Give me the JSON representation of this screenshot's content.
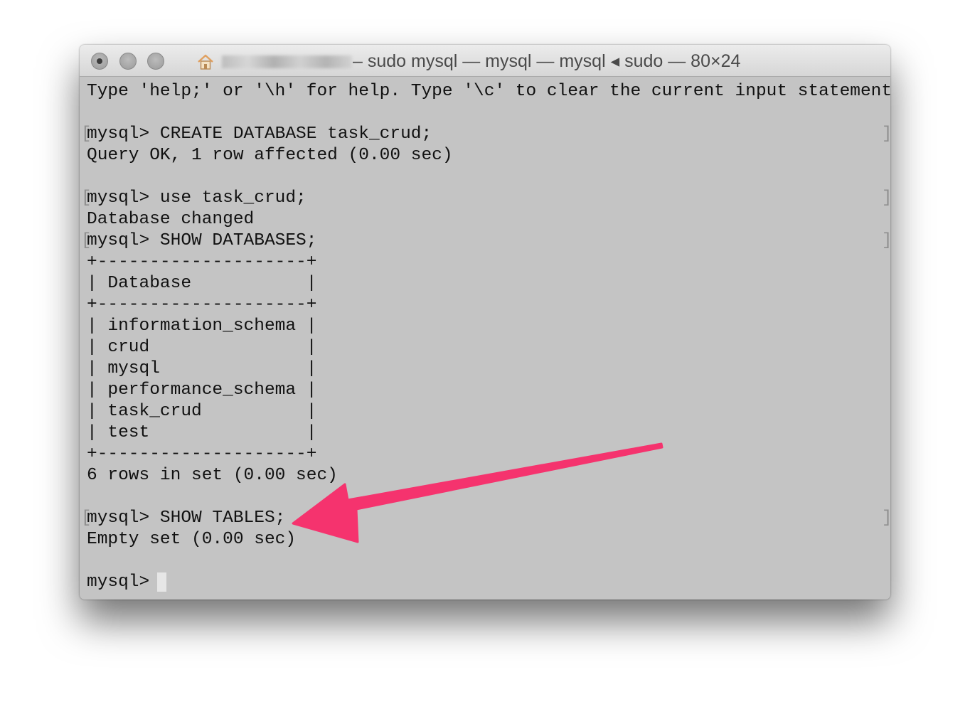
{
  "window": {
    "title": "– sudo mysql — mysql — mysql ◂ sudo — 80×24"
  },
  "terminal": {
    "lines": [
      "Type 'help;' or '\\h' for help. Type '\\c' to clear the current input statement.",
      "",
      "mysql> CREATE DATABASE task_crud;",
      "Query OK, 1 row affected (0.00 sec)",
      "",
      "mysql> use task_crud;",
      "Database changed",
      "mysql> SHOW DATABASES;",
      "+--------------------+",
      "| Database           |",
      "+--------------------+",
      "| information_schema |",
      "| crud               |",
      "| mysql              |",
      "| performance_schema |",
      "| task_crud          |",
      "| test               |",
      "+--------------------+",
      "6 rows in set (0.00 sec)",
      "",
      "mysql> SHOW TABLES;",
      "Empty set (0.00 sec)",
      "",
      "mysql> "
    ],
    "bracket_open": "[",
    "bracket_close": "]"
  },
  "colors": {
    "terminal_background": "#c4c4c4",
    "text": "#111111",
    "arrow": "#f5336e"
  },
  "icons": {
    "home": "home-icon",
    "annotation": "pink-arrow-icon"
  }
}
